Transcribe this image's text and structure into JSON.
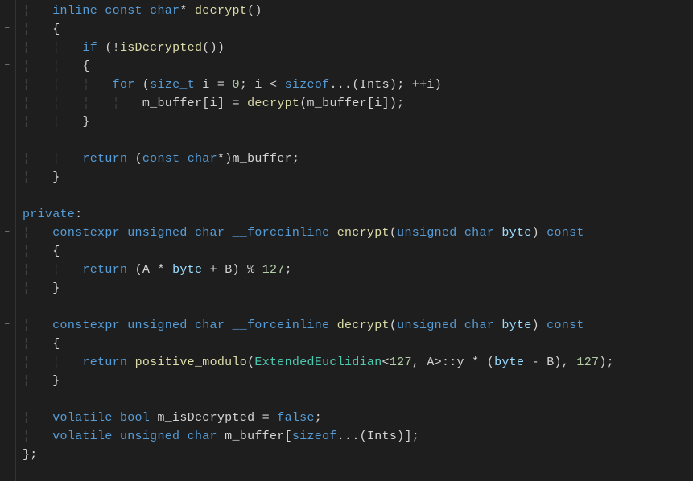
{
  "code": {
    "lines": [
      {
        "indent": 1,
        "tokens": [
          {
            "t": "inline ",
            "c": "kw"
          },
          {
            "t": "const ",
            "c": "kw"
          },
          {
            "t": "char",
            "c": "kw"
          },
          {
            "t": "* ",
            "c": "punc"
          },
          {
            "t": "decrypt",
            "c": "fn"
          },
          {
            "t": "()",
            "c": "punc"
          }
        ]
      },
      {
        "indent": 1,
        "tokens": [
          {
            "t": "{",
            "c": "punc"
          }
        ]
      },
      {
        "indent": 2,
        "tokens": [
          {
            "t": "if ",
            "c": "kw"
          },
          {
            "t": "(!",
            "c": "punc"
          },
          {
            "t": "isDecrypted",
            "c": "fn"
          },
          {
            "t": "())",
            "c": "punc"
          }
        ]
      },
      {
        "indent": 2,
        "tokens": [
          {
            "t": "{",
            "c": "punc"
          }
        ]
      },
      {
        "indent": 3,
        "tokens": [
          {
            "t": "for ",
            "c": "kw"
          },
          {
            "t": "(",
            "c": "punc"
          },
          {
            "t": "size_t",
            "c": "type"
          },
          {
            "t": " i = ",
            "c": "ident"
          },
          {
            "t": "0",
            "c": "num"
          },
          {
            "t": "; i < ",
            "c": "ident"
          },
          {
            "t": "sizeof",
            "c": "szof"
          },
          {
            "t": "...(",
            "c": "punc"
          },
          {
            "t": "Ints",
            "c": "ident"
          },
          {
            "t": "); ++i)",
            "c": "punc"
          }
        ]
      },
      {
        "indent": 4,
        "tokens": [
          {
            "t": "m_buffer",
            "c": "ident"
          },
          {
            "t": "[i] = ",
            "c": "punc"
          },
          {
            "t": "decrypt",
            "c": "fn"
          },
          {
            "t": "(",
            "c": "punc"
          },
          {
            "t": "m_buffer",
            "c": "ident"
          },
          {
            "t": "[i]);",
            "c": "punc"
          }
        ]
      },
      {
        "indent": 2,
        "tokens": [
          {
            "t": "}",
            "c": "punc"
          }
        ]
      },
      {
        "indent": 0,
        "tokens": []
      },
      {
        "indent": 2,
        "tokens": [
          {
            "t": "return ",
            "c": "kw"
          },
          {
            "t": "(",
            "c": "punc"
          },
          {
            "t": "const ",
            "c": "kw"
          },
          {
            "t": "char",
            "c": "kw"
          },
          {
            "t": "*)",
            "c": "punc"
          },
          {
            "t": "m_buffer",
            "c": "ident"
          },
          {
            "t": ";",
            "c": "punc"
          }
        ]
      },
      {
        "indent": 1,
        "tokens": [
          {
            "t": "}",
            "c": "punc"
          }
        ]
      },
      {
        "indent": 0,
        "tokens": []
      },
      {
        "indent": 0,
        "tokens": [
          {
            "t": "private",
            "c": "kw"
          },
          {
            "t": ":",
            "c": "punc"
          }
        ]
      },
      {
        "indent": 1,
        "tokens": [
          {
            "t": "constexpr ",
            "c": "kw"
          },
          {
            "t": "unsigned ",
            "c": "kw"
          },
          {
            "t": "char ",
            "c": "kw"
          },
          {
            "t": "__forceinline ",
            "c": "type"
          },
          {
            "t": "encrypt",
            "c": "fn"
          },
          {
            "t": "(",
            "c": "punc"
          },
          {
            "t": "unsigned ",
            "c": "kw"
          },
          {
            "t": "char ",
            "c": "kw"
          },
          {
            "t": "byte",
            "c": "param"
          },
          {
            "t": ") ",
            "c": "punc"
          },
          {
            "t": "const",
            "c": "kw"
          }
        ]
      },
      {
        "indent": 1,
        "tokens": [
          {
            "t": "{",
            "c": "punc"
          }
        ]
      },
      {
        "indent": 2,
        "tokens": [
          {
            "t": "return ",
            "c": "kw"
          },
          {
            "t": "(A * ",
            "c": "ident"
          },
          {
            "t": "byte",
            "c": "param"
          },
          {
            "t": " + B) % ",
            "c": "ident"
          },
          {
            "t": "127",
            "c": "num"
          },
          {
            "t": ";",
            "c": "punc"
          }
        ]
      },
      {
        "indent": 1,
        "tokens": [
          {
            "t": "}",
            "c": "punc"
          }
        ]
      },
      {
        "indent": 0,
        "tokens": []
      },
      {
        "indent": 1,
        "tokens": [
          {
            "t": "constexpr ",
            "c": "kw"
          },
          {
            "t": "unsigned ",
            "c": "kw"
          },
          {
            "t": "char ",
            "c": "kw"
          },
          {
            "t": "__forceinline ",
            "c": "type"
          },
          {
            "t": "decrypt",
            "c": "fn"
          },
          {
            "t": "(",
            "c": "punc"
          },
          {
            "t": "unsigned ",
            "c": "kw"
          },
          {
            "t": "char ",
            "c": "kw"
          },
          {
            "t": "byte",
            "c": "param"
          },
          {
            "t": ") ",
            "c": "punc"
          },
          {
            "t": "const",
            "c": "kw"
          }
        ]
      },
      {
        "indent": 1,
        "tokens": [
          {
            "t": "{",
            "c": "punc"
          }
        ]
      },
      {
        "indent": 2,
        "tokens": [
          {
            "t": "return ",
            "c": "kw"
          },
          {
            "t": "positive_modulo",
            "c": "fn"
          },
          {
            "t": "(",
            "c": "punc"
          },
          {
            "t": "ExtendedEuclidian",
            "c": "tmpl"
          },
          {
            "t": "<",
            "c": "punc"
          },
          {
            "t": "127",
            "c": "num"
          },
          {
            "t": ", A>::y * (",
            "c": "ident"
          },
          {
            "t": "byte",
            "c": "param"
          },
          {
            "t": " - B), ",
            "c": "ident"
          },
          {
            "t": "127",
            "c": "num"
          },
          {
            "t": ");",
            "c": "punc"
          }
        ]
      },
      {
        "indent": 1,
        "tokens": [
          {
            "t": "}",
            "c": "punc"
          }
        ]
      },
      {
        "indent": 0,
        "tokens": []
      },
      {
        "indent": 1,
        "tokens": [
          {
            "t": "volatile ",
            "c": "kw"
          },
          {
            "t": "bool ",
            "c": "kw"
          },
          {
            "t": "m_isDecrypted",
            "c": "ident"
          },
          {
            "t": " = ",
            "c": "punc"
          },
          {
            "t": "false",
            "c": "false"
          },
          {
            "t": ";",
            "c": "punc"
          }
        ]
      },
      {
        "indent": 1,
        "tokens": [
          {
            "t": "volatile ",
            "c": "kw"
          },
          {
            "t": "unsigned ",
            "c": "kw"
          },
          {
            "t": "char ",
            "c": "kw"
          },
          {
            "t": "m_buffer",
            "c": "ident"
          },
          {
            "t": "[",
            "c": "punc"
          },
          {
            "t": "sizeof",
            "c": "szof"
          },
          {
            "t": "...(",
            "c": "punc"
          },
          {
            "t": "Ints",
            "c": "ident"
          },
          {
            "t": ")];",
            "c": "punc"
          }
        ]
      },
      {
        "indent": 0,
        "tokens": [
          {
            "t": "};",
            "c": "punc"
          }
        ]
      }
    ]
  },
  "fold_markers": [
    {
      "line": 2,
      "symbol": "−"
    },
    {
      "line": 4,
      "symbol": "−"
    },
    {
      "line": 13,
      "symbol": "−"
    },
    {
      "line": 18,
      "symbol": "−"
    }
  ],
  "indent_width": 4,
  "indent_guide_char": "¦"
}
